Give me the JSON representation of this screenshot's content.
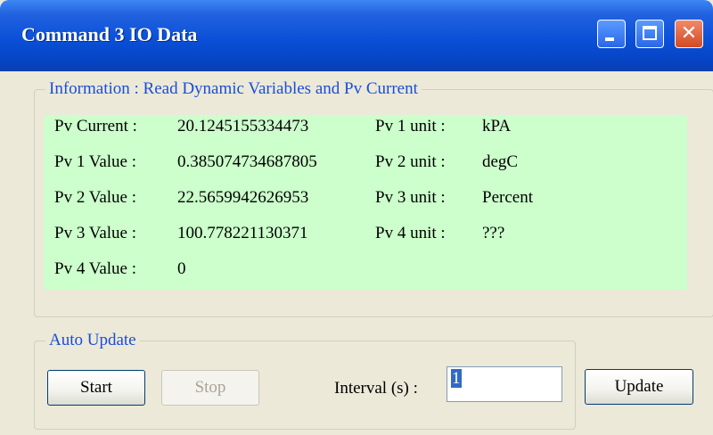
{
  "window": {
    "title": "Command 3 IO Data",
    "min_icon": "minimize-icon",
    "max_icon": "maximize-icon",
    "close_icon": "close-icon",
    "close_glyph": "✕"
  },
  "info_group": {
    "legend": "Information : Read Dynamic Variables and Pv Current",
    "rows": [
      {
        "label": "Pv Current :",
        "value": "20.1245155334473",
        "unit_label": "Pv 1 unit :",
        "unit_value": "kPA"
      },
      {
        "label": "Pv 1 Value :",
        "value": "0.385074734687805",
        "unit_label": "Pv 2 unit :",
        "unit_value": "degC"
      },
      {
        "label": "Pv 2 Value :",
        "value": "22.5659942626953",
        "unit_label": "Pv 3 unit :",
        "unit_value": "Percent"
      },
      {
        "label": "Pv 3 Value :",
        "value": "100.778221130371",
        "unit_label": "Pv 4 unit :",
        "unit_value": "???"
      },
      {
        "label": "Pv 4 Value :",
        "value": "0"
      }
    ],
    "panel_color": "#ccffcc"
  },
  "auto_group": {
    "legend": "Auto Update",
    "start_label": "Start",
    "stop_label": "Stop",
    "interval_label": "Interval (s) :",
    "interval_value": "1"
  },
  "update_label": "Update",
  "colors": {
    "title_bar": "#0a50d8",
    "legend_text": "#1a4dd8",
    "window_bg": "#ece9d8"
  }
}
